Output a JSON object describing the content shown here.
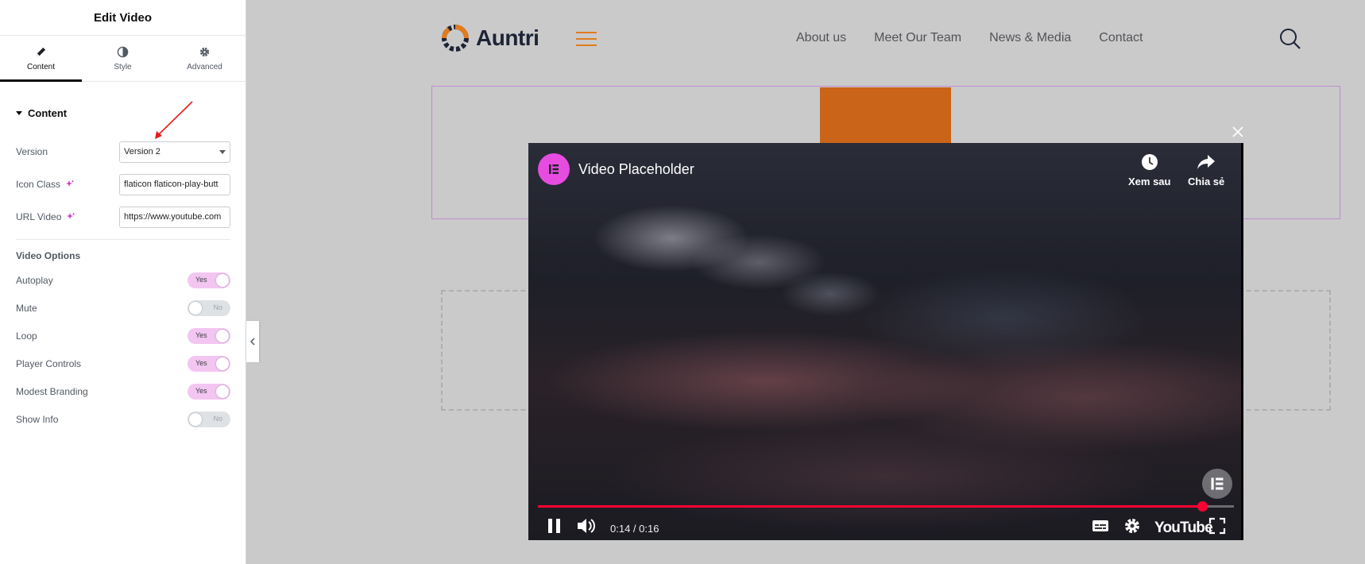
{
  "panel": {
    "title": "Edit Video",
    "tabs": [
      {
        "label": "Content",
        "icon": "pencil-icon",
        "active": true
      },
      {
        "label": "Style",
        "icon": "contrast-icon",
        "active": false
      },
      {
        "label": "Advanced",
        "icon": "gear-icon",
        "active": false
      }
    ],
    "section": "Content",
    "fields": {
      "version": {
        "label": "Version",
        "value": "Version 2"
      },
      "icon_class": {
        "label": "Icon Class",
        "value": "flaticon flaticon-play-butt"
      },
      "url_video": {
        "label": "URL Video",
        "value": "https://www.youtube.com"
      }
    },
    "options_title": "Video Options",
    "toggles": [
      {
        "label": "Autoplay",
        "state": "Yes"
      },
      {
        "label": "Mute",
        "state": "No"
      },
      {
        "label": "Loop",
        "state": "Yes"
      },
      {
        "label": "Player Controls",
        "state": "Yes"
      },
      {
        "label": "Modest Branding",
        "state": "Yes"
      },
      {
        "label": "Show Info",
        "state": "No"
      }
    ]
  },
  "site": {
    "logo": "Auntri",
    "nav": [
      "About us",
      "Meet Our Team",
      "News & Media",
      "Contact"
    ]
  },
  "video": {
    "title": "Video Placeholder",
    "watch_later": "Xem sau",
    "share": "Chia sẻ",
    "time": "0:14 / 0:16",
    "progress": 0.955,
    "wordmark": "YouTube"
  },
  "colors": {
    "accent_pink": "#f3c5f1",
    "brand_orange": "#e07b1f",
    "progress_red": "#ff0033",
    "channel_pink": "#e64ce0"
  }
}
